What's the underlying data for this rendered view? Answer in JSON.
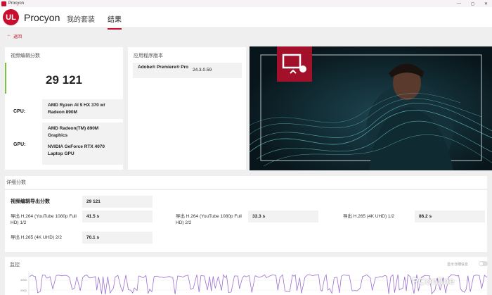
{
  "window": {
    "title": "Procyon",
    "controls": [
      "—",
      "◻",
      "✕"
    ]
  },
  "header": {
    "brand": "Procyon",
    "logo_text": "UL",
    "tabs": [
      {
        "label": "我的套装",
        "active": false
      },
      {
        "label": "结果",
        "active": true
      }
    ]
  },
  "back_label": "返回",
  "score_card": {
    "title": "视频编辑分数",
    "score": "29 121",
    "cpu_label": "CPU:",
    "cpu_value": "AMD Ryzen AI 9 HX 370 w/ Radeon 890M",
    "gpu_label": "GPU:",
    "gpu_value_1": "AMD Radeon(TM) 890M Graphics",
    "gpu_value_2": "NVIDIA GeForce RTX 4070 Laptop GPU"
  },
  "app_card": {
    "title": "应用程序版本",
    "app_name": "Adobe® Premiere® Pro",
    "app_version": "24.3.0.59"
  },
  "details": {
    "title": "详细分数",
    "export_label": "视频编辑导出分数",
    "export_score": "29 121",
    "items": [
      {
        "label": "导出 H.264 (YouTube 1080p Full HD) 1/2",
        "value": "41.5 s"
      },
      {
        "label": "导出 H.264 (YouTube 1080p Full HD) 2/2",
        "value": "33.3 s"
      },
      {
        "label": "导出 H.265 (4K UHD) 1/2",
        "value": "86.2 s"
      },
      {
        "label": "导出 H.265 (4K UHD) 2/2",
        "value": "70.1 s"
      }
    ]
  },
  "monitoring": {
    "title": "监控",
    "toggle_label": "显示详细信息",
    "y_ticks": [
      "4000",
      "2000"
    ]
  },
  "watermark": "PConline",
  "colors": {
    "accent": "#c8102e",
    "score_bar": "#7bc142",
    "chart_line": "#9c6fd1"
  }
}
